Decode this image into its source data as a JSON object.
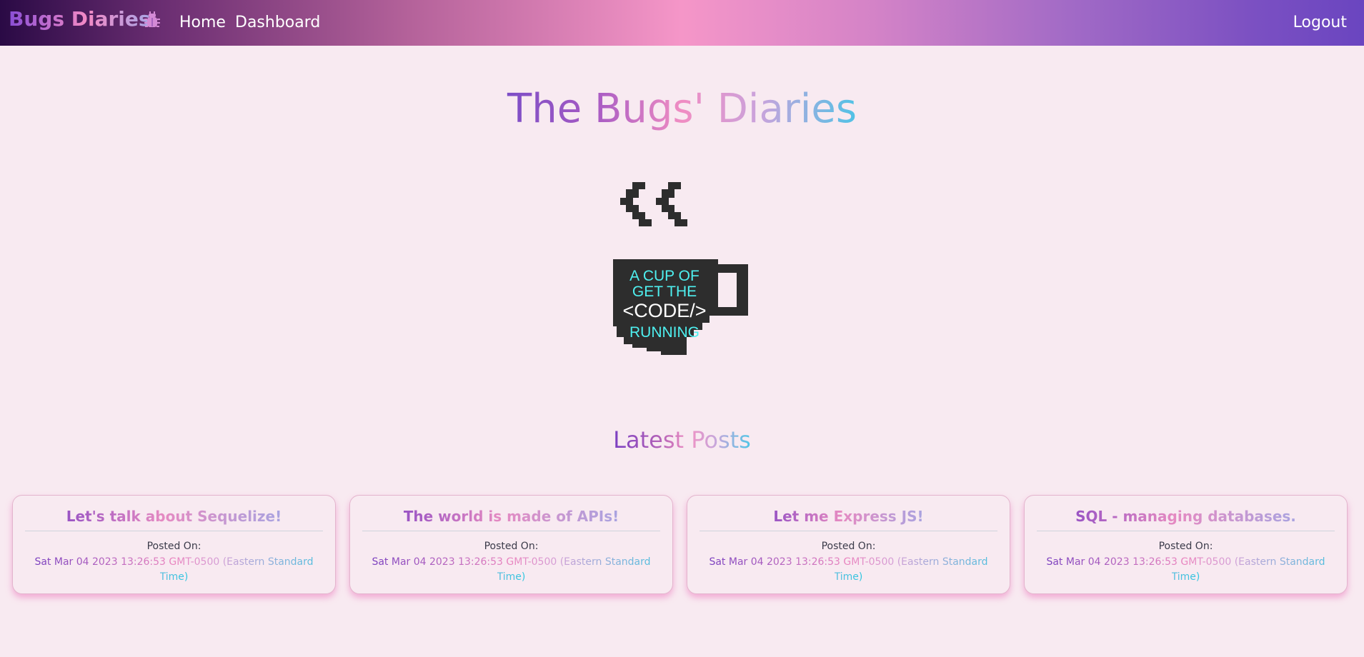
{
  "navbar": {
    "brand": "Bugs Diaries",
    "brand_icon": "bug-icon",
    "links": [
      "Home",
      "Dashboard"
    ],
    "logout": "Logout"
  },
  "hero": {
    "title": "The Bugs' Diaries",
    "logo": {
      "line1": "A CUP OF",
      "line2": "GET THE",
      "line3": "<CODE/>",
      "line4": "RUNNING"
    }
  },
  "latest": {
    "heading": "Latest Posts",
    "posts": [
      {
        "title": "Let's talk about Sequelize!",
        "posted_label": "Posted On:",
        "date": "Sat Mar 04 2023 13:26:53 GMT-0500 (Eastern Standard Time)"
      },
      {
        "title": "The world is made of APIs!",
        "posted_label": "Posted On:",
        "date": "Sat Mar 04 2023 13:26:53 GMT-0500 (Eastern Standard Time)"
      },
      {
        "title": "Let me Express JS!",
        "posted_label": "Posted On:",
        "date": "Sat Mar 04 2023 13:26:53 GMT-0500 (Eastern Standard Time)"
      },
      {
        "title": "SQL - managing databases.",
        "posted_label": "Posted On:",
        "date": "Sat Mar 04 2023 13:26:53 GMT-0500 (Eastern Standard Time)"
      }
    ]
  },
  "colors": {
    "background": "#f8eaf1",
    "accent_purple": "#7b4dc6",
    "accent_pink": "#f08dc3",
    "accent_cyan": "#4cc3e6",
    "logo_text": "#4ef0f0",
    "logo_mug": "#2d2d2d"
  }
}
